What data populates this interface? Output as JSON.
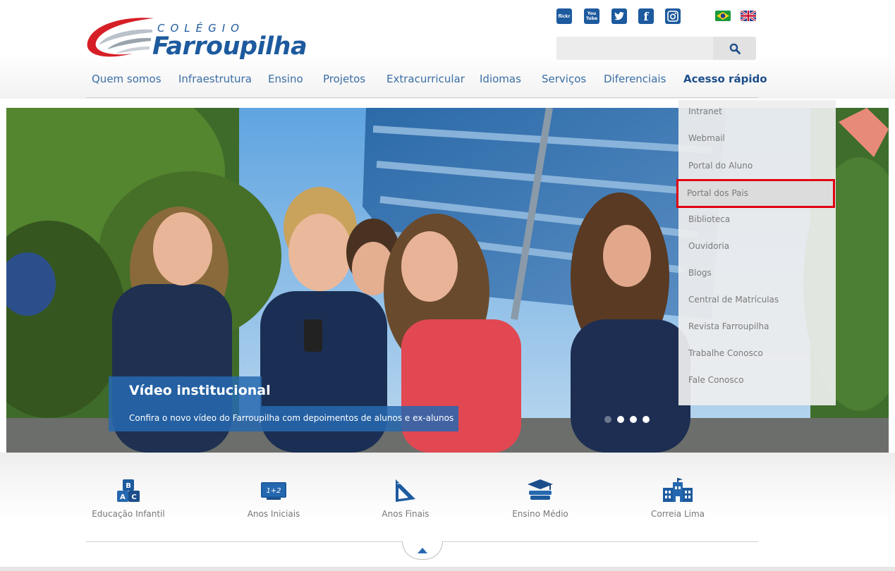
{
  "brand": {
    "logo_small": "COLÉGIO",
    "logo_big": "Farroupilha",
    "primary_color": "#1d5a9e",
    "accent_color": "#2668b0"
  },
  "social": {
    "flickr": "flickr",
    "youtube": "You Tube",
    "twitter": "twitter-icon",
    "facebook": "f",
    "instagram": "instagram-icon"
  },
  "languages": [
    "pt-BR",
    "en-GB"
  ],
  "search": {
    "placeholder": "",
    "value": ""
  },
  "nav": {
    "items": [
      "Quem somos",
      "Infraestrutura",
      "Ensino",
      "Projetos",
      "Extracurricular",
      "Idiomas",
      "Serviços",
      "Diferenciais"
    ],
    "active": "Acesso rápido"
  },
  "hero": {
    "title": "Vídeo institucional",
    "subtitle": "Confira o novo vídeo do Farroupilha com depoimentos de alunos e ex-alunos",
    "slides": 4,
    "current_slide": 1
  },
  "dropdown": {
    "items": [
      "Intranet",
      "Webmail",
      "Portal do Aluno",
      "Portal dos Pais",
      "Biblioteca",
      "Ouvidoria",
      "Blogs",
      "Central de Matrículas",
      "Revista Farroupilha",
      "Trabalhe Conosco",
      "Fale Conosco"
    ],
    "highlighted": "Portal dos Pais",
    "highlight_color": "#e0000f"
  },
  "levels": [
    {
      "label": "Educação Infantil",
      "icon": "abc-blocks-icon"
    },
    {
      "label": "Anos Iniciais",
      "icon": "chalkboard-icon",
      "icon_text": "1+2"
    },
    {
      "label": "Anos Finais",
      "icon": "ruler-triangle-icon"
    },
    {
      "label": "Ensino Médio",
      "icon": "books-graduation-icon"
    },
    {
      "label": "Correia Lima",
      "icon": "school-building-icon"
    }
  ]
}
